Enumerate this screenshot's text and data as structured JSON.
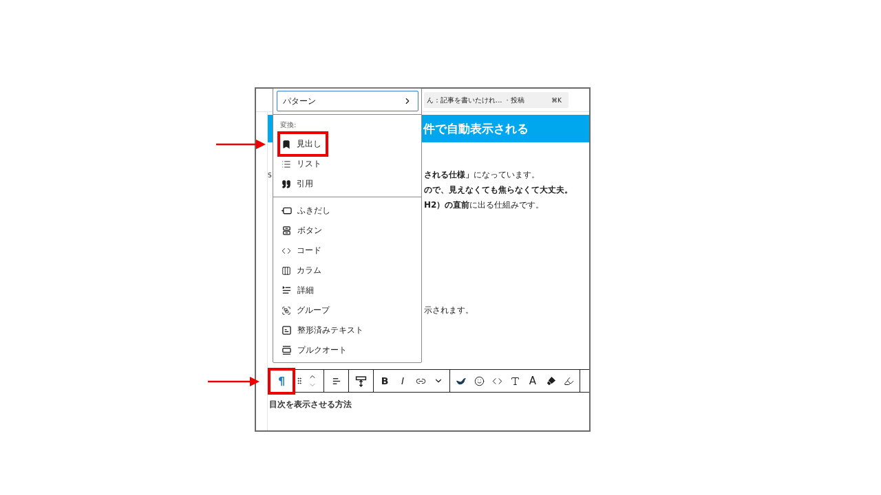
{
  "top_bar": {
    "search": {
      "text": "ん：記事を書いたけれ...",
      "suffix": "· 投稿",
      "shortcut": "⌘K"
    }
  },
  "heading": "件で自動表示される",
  "paragraph_lines": [
    {
      "left": "S",
      "right": "**される仕様」**になっています。",
      "bold": false
    },
    {
      "right": "ので、見えなくても焦らなくて大丈夫。",
      "bold": true
    },
    {
      "right": "**H2）の直前**に出る仕組みです。",
      "bold": false
    }
  ],
  "lower_line": {
    "right": "示されます。"
  },
  "toolbar": {
    "groups": [
      {
        "items": [
          {
            "kind": "paragraph",
            "label": "¶",
            "highlighted": true
          },
          {
            "kind": "drag",
            "highlighted": false
          },
          {
            "kind": "move",
            "highlighted": false
          }
        ]
      },
      {
        "items": [
          {
            "kind": "align",
            "highlighted": false
          }
        ]
      },
      {
        "items": [
          {
            "kind": "width",
            "highlighted": false
          }
        ]
      },
      {
        "items": [
          {
            "kind": "bold",
            "label": "B",
            "highlighted": false
          },
          {
            "kind": "italic",
            "label": "I",
            "highlighted": false
          },
          {
            "kind": "link",
            "highlighted": false
          },
          {
            "kind": "more",
            "highlighted": false
          }
        ]
      },
      {
        "items": [
          {
            "kind": "bird",
            "highlighted": false
          },
          {
            "kind": "emoji",
            "highlighted": false
          },
          {
            "kind": "code",
            "highlighted": false
          },
          {
            "kind": "text_size",
            "highlighted": false
          },
          {
            "kind": "text_color",
            "label": "A",
            "highlighted": false
          },
          {
            "kind": "marker",
            "highlighted": false
          },
          {
            "kind": "highlighter",
            "highlighted": false
          }
        ]
      }
    ]
  },
  "block_title": "目次を表示させる方法",
  "menu": {
    "pattern_button": "パターン",
    "section_label": "変換:",
    "groups": [
      {
        "items": [
          {
            "kind": "heading",
            "label": "見出し",
            "highlighted": true
          },
          {
            "kind": "list",
            "label": "リスト",
            "highlighted": false
          },
          {
            "kind": "quote",
            "label": "引用",
            "highlighted": false
          }
        ]
      },
      {
        "items": [
          {
            "kind": "balloon",
            "label": "ふきだし",
            "highlighted": false
          },
          {
            "kind": "button",
            "label": "ボタン",
            "highlighted": false
          },
          {
            "kind": "code",
            "label": "コード",
            "highlighted": false
          },
          {
            "kind": "columns",
            "label": "カラム",
            "highlighted": false
          },
          {
            "kind": "details",
            "label": "詳細",
            "highlighted": false
          },
          {
            "kind": "group",
            "label": "グループ",
            "highlighted": false
          },
          {
            "kind": "preformatted",
            "label": "整形済みテキスト",
            "highlighted": false
          },
          {
            "kind": "pullquote",
            "label": "プルクオート",
            "highlighted": false
          }
        ]
      }
    ]
  }
}
